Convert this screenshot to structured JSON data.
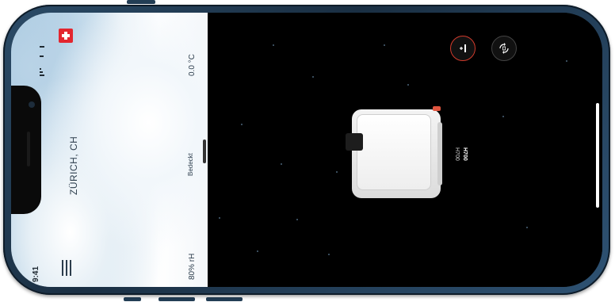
{
  "status_bar": {
    "time": "9:41"
  },
  "weather": {
    "location": "ZÜRICH, CH",
    "condition": "Bedeckt",
    "temperature": "0.0 °C",
    "humidity": "80% rH"
  },
  "device": {
    "model_line_1": "H700",
    "model_line_2": "H700"
  },
  "icons": {
    "flag": "swiss-flag-icon",
    "menu": "hamburger-menu-icon",
    "add_device": "add-device-icon",
    "sync": "sync-icon"
  },
  "colors": {
    "accent_red": "#d23b2c",
    "frame_blue": "#2b4b67"
  }
}
